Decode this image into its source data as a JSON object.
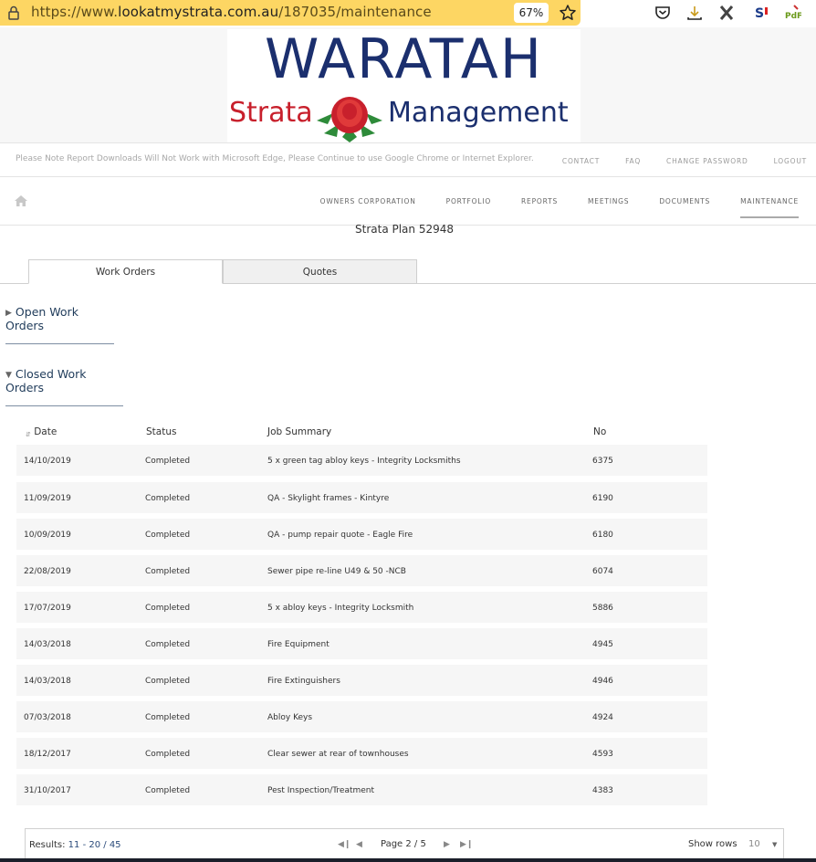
{
  "browser": {
    "url_prefix": "https://www.",
    "url_domain": "lookatmystrata.com.au",
    "url_path": "/187035/maintenance",
    "zoom": "67%"
  },
  "logo": {
    "top": "WARATAH",
    "strata": "Strata",
    "management": "Management"
  },
  "notice": "Please Note Report Downloads Will Not Work with Microsoft Edge, Please Continue to use Google Chrome or Internet Explorer.",
  "top_links": [
    "CONTACT",
    "FAQ",
    "CHANGE PASSWORD",
    "LOGOUT"
  ],
  "nav": [
    "OWNERS CORPORATION",
    "PORTFOLIO",
    "REPORTS",
    "MEETINGS",
    "DOCUMENTS",
    "MAINTENANCE"
  ],
  "plan_title": "Strata Plan 52948",
  "tabs": [
    "Work Orders",
    "Quotes"
  ],
  "sections": {
    "open": "Open Work Orders",
    "closed": "Closed Work Orders"
  },
  "table": {
    "headers": [
      "Date",
      "Status",
      "Job Summary",
      "No"
    ],
    "rows": [
      [
        "14/10/2019",
        "Completed",
        "5 x green tag abloy keys - Integrity Locksmiths",
        "6375"
      ],
      [
        "11/09/2019",
        "Completed",
        "QA - Skylight frames - Kintyre",
        "6190"
      ],
      [
        "10/09/2019",
        "Completed",
        "QA - pump repair quote - Eagle Fire",
        "6180"
      ],
      [
        "22/08/2019",
        "Completed",
        "Sewer pipe re-line U49 & 50 -NCB",
        "6074"
      ],
      [
        "17/07/2019",
        "Completed",
        "5 x abloy keys - Integrity Locksmith",
        "5886"
      ],
      [
        "14/03/2018",
        "Completed",
        "Fire Equipment",
        "4945"
      ],
      [
        "14/03/2018",
        "Completed",
        "Fire Extinguishers",
        "4946"
      ],
      [
        "07/03/2018",
        "Completed",
        "Abloy Keys",
        "4924"
      ],
      [
        "18/12/2017",
        "Completed",
        "Clear sewer at rear of townhouses",
        "4593"
      ],
      [
        "31/10/2017",
        "Completed",
        "Pest Inspection/Treatment",
        "4383"
      ]
    ]
  },
  "pager": {
    "results_label": "Results:",
    "results_value": "11 - 20 / 45",
    "page_label": "Page 2 / 5",
    "show_rows_label": "Show rows",
    "rows_value": "10"
  },
  "colors": {
    "url_bar": "#fdd663",
    "logo_blue": "#1b2f6e",
    "logo_red": "#c8202c",
    "section_blue": "#1f3b5a"
  }
}
